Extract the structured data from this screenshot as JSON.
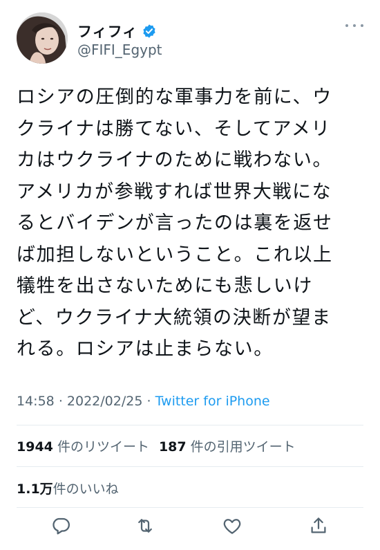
{
  "user": {
    "display_name": "フィフィ",
    "handle": "@FIFI_Egypt",
    "verified": true
  },
  "tweet": {
    "lines": [
      "ロシアの圧倒的な軍事力を前に、ウ",
      "クライナは勝てない、そしてアメリ",
      "カはウクライナのために戦わない。",
      "アメリカが参戦すれば世界大戦にな",
      "るとバイデンが言ったのは裏を返せ",
      "ば加担しないということ。これ以上",
      "犠牲を出さないためにも悲しいけ",
      "ど、ウクライナ大統領の決断が望ま",
      "れる。ロシアは止まらない。"
    ],
    "time": "14:58",
    "separator": "·",
    "date": "2022/02/25",
    "source": "Twitter for iPhone"
  },
  "stats": {
    "retweets_count": "1944",
    "retweets_label": "件のリツイート",
    "quotes_count": "187",
    "quotes_label": "件の引用ツイート",
    "likes_count": "1.1万",
    "likes_label": "件のいいね"
  },
  "icons": {
    "more": "more-icon",
    "verified": "verified-badge-icon",
    "reply": "reply-icon",
    "retweet": "retweet-icon",
    "like": "like-icon",
    "share": "share-icon"
  },
  "colors": {
    "accent": "#1d9bf0",
    "secondary_text": "#536471",
    "icon": "#536471"
  }
}
